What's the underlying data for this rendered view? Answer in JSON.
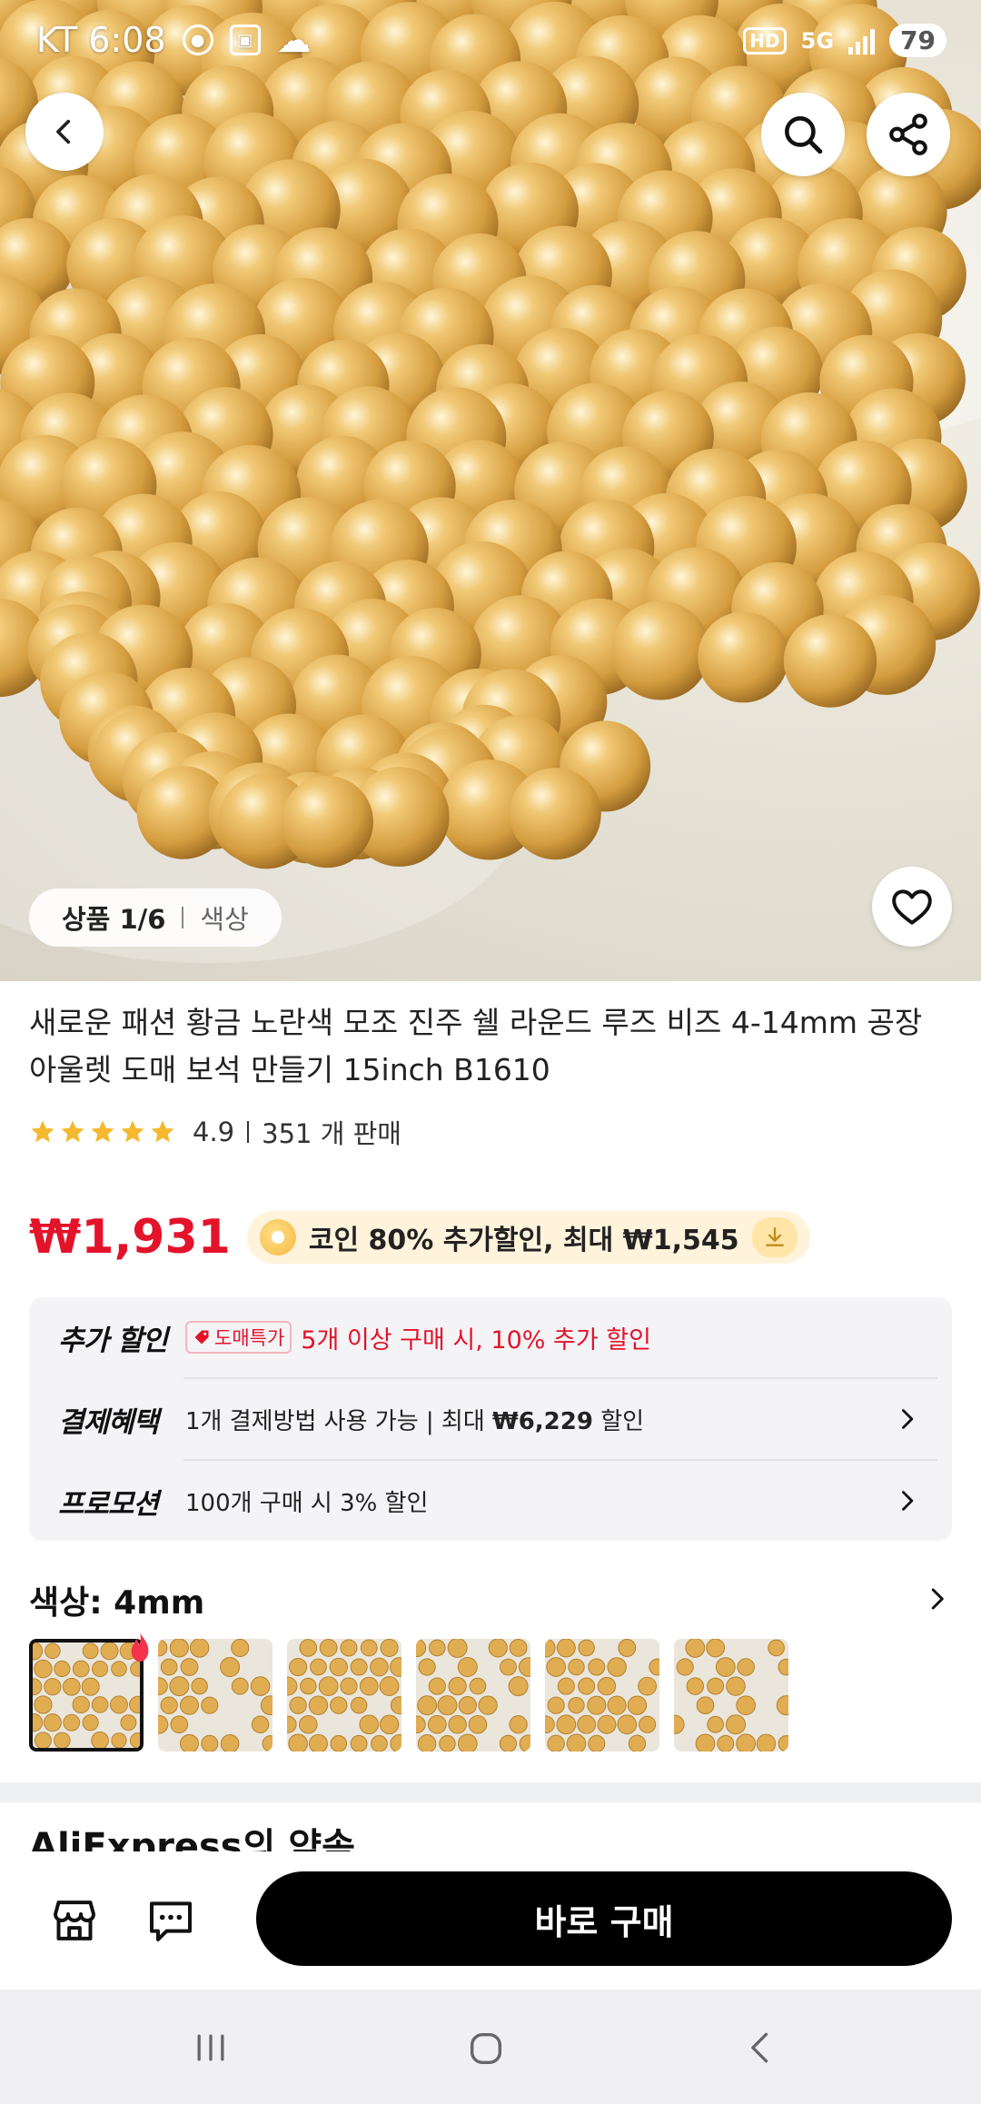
{
  "status_bar": {
    "carrier_time": "KT 6:08",
    "network": "5G",
    "hd_label": "HD",
    "battery": "79"
  },
  "image_gallery": {
    "counter": "상품 1/6",
    "counter_label": "색상"
  },
  "product": {
    "title": "새로운 패션 황금 노란색 모조 진주 쉘 라운드 루즈 비즈 4-14mm 공장 아울렛 도매 보석 만들기 15inch B1610",
    "rating": "4.9",
    "sold": "351 개 판매",
    "stars": 5,
    "price": "₩1,931",
    "coin_text": "코인 80% 추가할인, 최대 ₩1,545"
  },
  "benefits": {
    "extra_label": "추가 할인",
    "extra_tag": "도매특가",
    "extra_text": "5개 이상 구매 시, 10% 추가 할인",
    "payment_label": "결제혜택",
    "payment_count": "1",
    "payment_text": "개 결제방법 사용 가능 | 최대 ",
    "payment_amount": "₩6,229",
    "payment_suffix": " 할인",
    "promo_label": "프로모션",
    "promo_text": "100개 구매 시 3% 할인"
  },
  "variant": {
    "label": "색상: 4mm",
    "thumb_count": 6
  },
  "next_section": {
    "title": "AliExpress의 약속"
  },
  "bottom_bar": {
    "buy_label": "바로 구매"
  },
  "colors": {
    "price_red": "#e3132a",
    "pearl_gold": "#e0ad52",
    "buy_black": "#000000",
    "star_gold": "#f5b82e"
  }
}
